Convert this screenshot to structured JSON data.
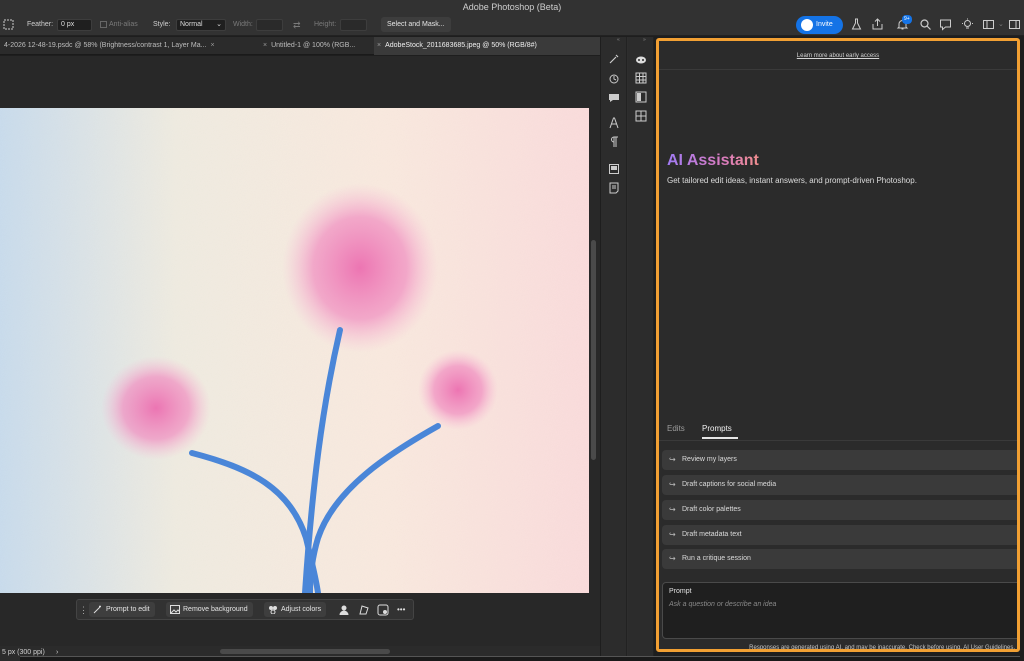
{
  "window": {
    "title": "Adobe Photoshop (Beta)"
  },
  "options_bar": {
    "feather_label": "Feather:",
    "feather_value": "0 px",
    "antialias_label": "Anti-alias",
    "style_label": "Style:",
    "style_value": "Normal",
    "width_label": "Width:",
    "height_label": "Height:",
    "select_mask_label": "Select and Mask...",
    "invite_label": "Invite",
    "notification_count": "9+"
  },
  "doc_tabs": [
    {
      "label": "4-2026 12-48-19.psdc @ 58% (Brightness/contrast 1, Layer Ma...",
      "active": false
    },
    {
      "label": "Untitled-1 @ 100% (RGB...",
      "active": false
    },
    {
      "label": "AdobeStock_2011683685.jpeg @ 50% (RGB/8#)",
      "active": true
    }
  ],
  "contextual_bar": {
    "prompt_to_edit": "Prompt to edit",
    "remove_background": "Remove background",
    "adjust_colors": "Adjust colors",
    "more": "•••"
  },
  "status_bar": {
    "info": "5 px (300 ppi)",
    "arrow": "›"
  },
  "ai_panel": {
    "learn_more": "Learn more about early access",
    "title": "AI Assistant",
    "subtitle": "Get tailored edit ideas, instant answers, and prompt-driven Photoshop.",
    "tabs": [
      {
        "label": "Edits",
        "active": false
      },
      {
        "label": "Prompts",
        "active": true
      }
    ],
    "suggestions": [
      "Review my layers",
      "Draft captions for social media",
      "Draft color palettes",
      "Draft metadata text",
      "Run a critique session"
    ],
    "prompt_label": "Prompt",
    "prompt_placeholder": "Ask a question or describe an idea",
    "disclaimer": "Responses are generated using AI, and may be inaccurate. Check before using. AI User Guidelines.",
    "border_color": "#f2a033"
  },
  "colors": {
    "invite_blue": "#1473e6",
    "flower_pink": "#ec6fb0",
    "stem_blue": "#4a86d8"
  }
}
